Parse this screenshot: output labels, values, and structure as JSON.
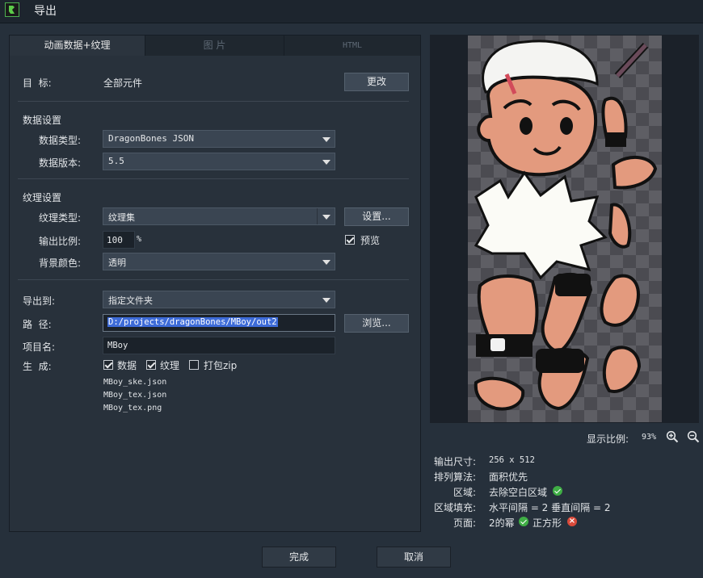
{
  "window": {
    "title": "导出",
    "icon": "app-icon"
  },
  "tabs": [
    {
      "label": "动画数据+纹理",
      "active": true
    },
    {
      "label": "图 片",
      "active": false
    },
    {
      "label": "HTML",
      "active": false
    }
  ],
  "target": {
    "label": "目  标:",
    "value": "全部元件",
    "change_button": "更改"
  },
  "data_settings": {
    "heading": "数据设置",
    "type_label": "数据类型:",
    "type_value": "DragonBones JSON",
    "version_label": "数据版本:",
    "version_value": "5.5"
  },
  "texture_settings": {
    "heading": "纹理设置",
    "type_label": "纹理类型:",
    "type_value": "纹理集",
    "settings_button": "设置...",
    "scale_label": "输出比例:",
    "scale_value": "100",
    "scale_unit": "%",
    "preview_label": "预览",
    "preview_checked": true,
    "bg_label": "背景颜色:",
    "bg_value": "透明"
  },
  "export": {
    "to_label": "导出到:",
    "to_value": "指定文件夹",
    "path_label": "路  径:",
    "path_value": "D:/projects/dragonBones/MBoy/out2",
    "browse_button": "浏览...",
    "project_label": "项目名:",
    "project_value": "MBoy",
    "generate_label": "生  成:",
    "gen_data": "数据",
    "gen_texture": "纹理",
    "gen_zip": "打包zip",
    "files": [
      "MBoy_ske.json",
      "MBoy_tex.json",
      "MBoy_tex.png"
    ]
  },
  "preview": {
    "zoom_label": "显示比例:",
    "zoom_value": "93%",
    "info": {
      "size_label": "输出尺寸:",
      "size_value": "256 x 512",
      "algo_label": "排列算法:",
      "algo_value": "面积优先",
      "region_label": "区域:",
      "region_value": "去除空白区域",
      "fill_label": "区域填充:",
      "fill_value": "水平间隔 = 2 垂直间隔 = 2",
      "page_label": "页面:",
      "page_value_1": "2的幂",
      "page_value_2": "正方形"
    }
  },
  "buttons": {
    "done": "完成",
    "cancel": "取消"
  },
  "colors": {
    "accent_ok": "#3fae45",
    "accent_error": "#d94a3a",
    "selection": "#3d6bd8"
  }
}
